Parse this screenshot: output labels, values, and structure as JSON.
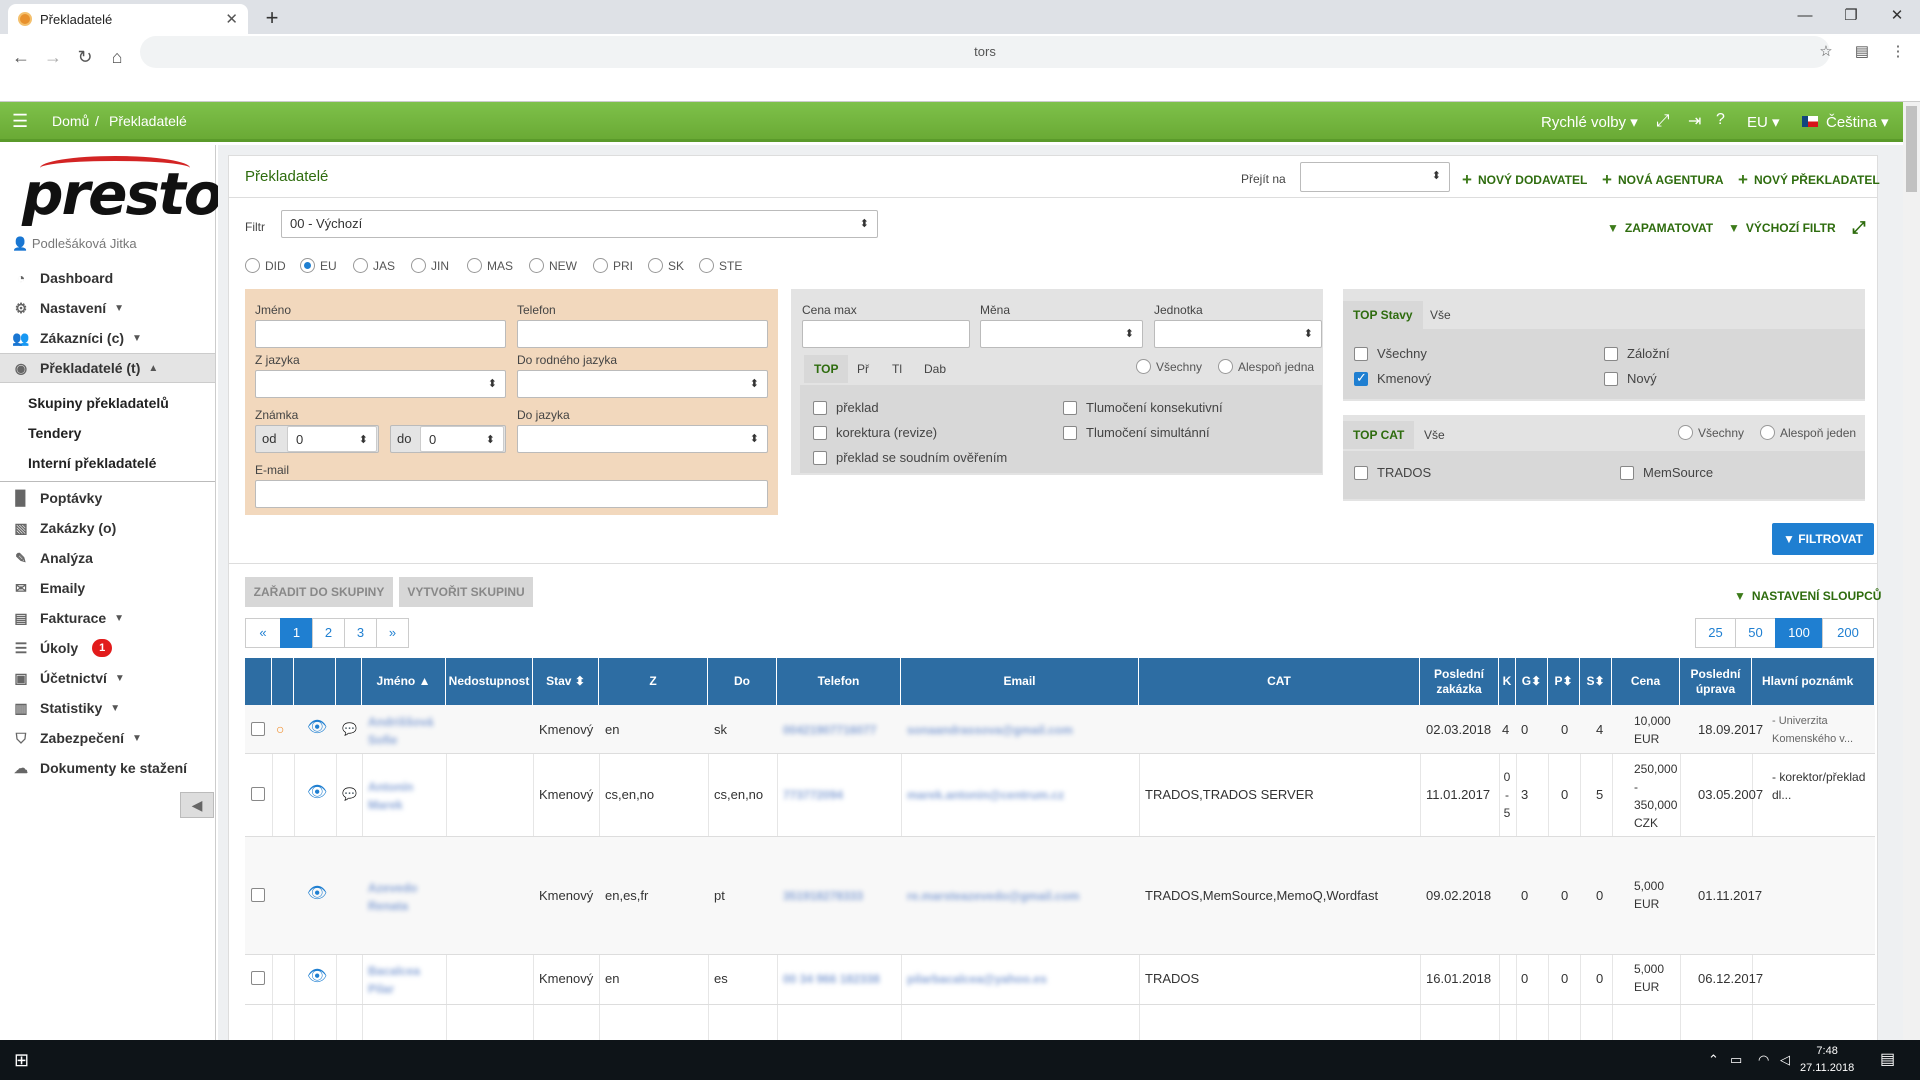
{
  "browser": {
    "tab_title": "Překladatelé",
    "address": "tors"
  },
  "header": {
    "home": "Domů",
    "separator": "/",
    "current": "Překladatelé",
    "quick": "Rychlé volby",
    "region": "EU",
    "language": "Čeština"
  },
  "sidebar": {
    "logo": "presto",
    "user": "Podlešáková Jitka",
    "items": [
      "Dashboard",
      "Nastavení",
      "Zákazníci (c)",
      "Překladatelé (t)"
    ],
    "sub": [
      "Skupiny překladatelů",
      "Tendery",
      "Interní překladatelé"
    ],
    "items2": [
      "Poptávky",
      "Zakázky (o)",
      "Analýza",
      "Emaily",
      "Fakturace",
      "Úkoly",
      "Účetnictví",
      "Statistiky",
      "Zabezpečení",
      "Dokumenty ke stažení"
    ],
    "tasks_badge": "1"
  },
  "page": {
    "title": "Překladatelé",
    "goto_label": "Přejít na",
    "new_supplier": "NOVÝ DODAVATEL",
    "new_agency": "NOVÁ AGENTURA",
    "new_translator": "NOVÝ PŘEKLADATEL"
  },
  "filter": {
    "label": "Filtr",
    "value": "00 - Výchozí",
    "remember": "ZAPAMATOVAT",
    "default": "VÝCHOZÍ FILTR",
    "regions": [
      "DID",
      "EU",
      "JAS",
      "JIN",
      "MAS",
      "NEW",
      "PRI",
      "SK",
      "STE"
    ],
    "name": "Jméno",
    "phone": "Telefon",
    "from_lang": "Z jazyka",
    "native_lang": "Do rodného jazyka",
    "grade": "Známka",
    "grade_from": "od",
    "grade_from_val": "0",
    "grade_to": "do",
    "grade_to_val": "0",
    "to_lang": "Do jazyka",
    "email": "E-mail",
    "price_max": "Cena max",
    "currency": "Měna",
    "unit": "Jednotka",
    "svc_tabs": [
      "TOP",
      "Př",
      "Tl",
      "Dab"
    ],
    "all": "Všechny",
    "atleast": "Alespoň jedna",
    "services": [
      "překlad",
      "korektura (revize)",
      "překlad se soudním ověřením",
      "Tlumočení konsekutivní",
      "Tlumočení simultánní"
    ],
    "state_tabs": [
      "TOP Stavy",
      "Vše"
    ],
    "states": [
      "Všechny",
      "Kmenový",
      "Záložní",
      "Nový"
    ],
    "cat_tabs": [
      "TOP CAT",
      "Vše"
    ],
    "cat_all": "Všechny",
    "cat_atleast": "Alespoň jeden",
    "cats": [
      "TRADOS",
      "MemSource"
    ],
    "submit": "FILTROVAT"
  },
  "actions": {
    "add_to_group": "ZAŘADIT DO SKUPINY",
    "create_group": "VYTVOŘIT SKUPINU",
    "columns": "NASTAVENÍ SLOUPCŮ"
  },
  "pagination": {
    "prev": "«",
    "pages": [
      "1",
      "2",
      "3"
    ],
    "next": "»",
    "sizes": [
      "25",
      "50",
      "100",
      "200"
    ]
  },
  "table": {
    "headers": [
      "Jméno",
      "Nedostupnost",
      "Stav",
      "Z",
      "Do",
      "Telefon",
      "Email",
      "CAT",
      "Poslední zakázka",
      "K",
      "G",
      "P",
      "S",
      "Cena",
      "Poslední úprava",
      "Hlavní poznámk"
    ],
    "rows": [
      {
        "name": "Andriššová Sofie",
        "stav": "Kmenový",
        "z": "en",
        "do": "sk",
        "tel": "00421907716077",
        "email": "sonaandrassova@gmail.com",
        "cat": "",
        "last": "02.03.2018",
        "k": "4",
        "g": "0",
        "p": "0",
        "s": "4",
        "price": "10,000 EUR",
        "upd": "18.09.2017",
        "note": "- Univerzita Komenského v..."
      },
      {
        "name": "Antonín Marek",
        "stav": "Kmenový",
        "z": "cs,en,no",
        "do": "cs,en,no",
        "tel": "773772094",
        "email": "marek.antonin@centrum.cz",
        "cat": "TRADOS,TRADOS SERVER",
        "last": "11.01.2017",
        "k": "0 - 5",
        "g": "3",
        "p": "0",
        "s": "5",
        "price": "250,000 - 350,000 CZK",
        "upd": "03.05.2007",
        "note": "- korektor/překlad dl..."
      },
      {
        "name": "Azevedo Renata",
        "stav": "Kmenový",
        "z": "en,es,fr",
        "do": "pt",
        "tel": "351918278333",
        "email": "re.marsteazevedo@gmail.com",
        "cat": "TRADOS,MemSource,MemoQ,Wordfast",
        "last": "09.02.2018",
        "k": "",
        "g": "0",
        "p": "0",
        "s": "0",
        "price": "5,000 EUR",
        "upd": "01.11.2017",
        "note": ""
      },
      {
        "name": "Bacalcea Pilar",
        "stav": "Kmenový",
        "z": "en",
        "do": "es",
        "tel": "00 34 966 182338",
        "email": "pilarbacalcea@yahoo.es",
        "cat": "TRADOS",
        "last": "16.01.2018",
        "k": "",
        "g": "0",
        "p": "0",
        "s": "0",
        "price": "5,000 EUR",
        "upd": "06.12.2017",
        "note": ""
      }
    ]
  },
  "taskbar": {
    "time": "7:48",
    "date": "27.11.2018"
  },
  "colors": {
    "green": "#6aaa35",
    "blue": "#1f7fd1",
    "table_head": "#2d6da3",
    "peach": "#f2d8bd",
    "badge": "#e21b1b"
  }
}
